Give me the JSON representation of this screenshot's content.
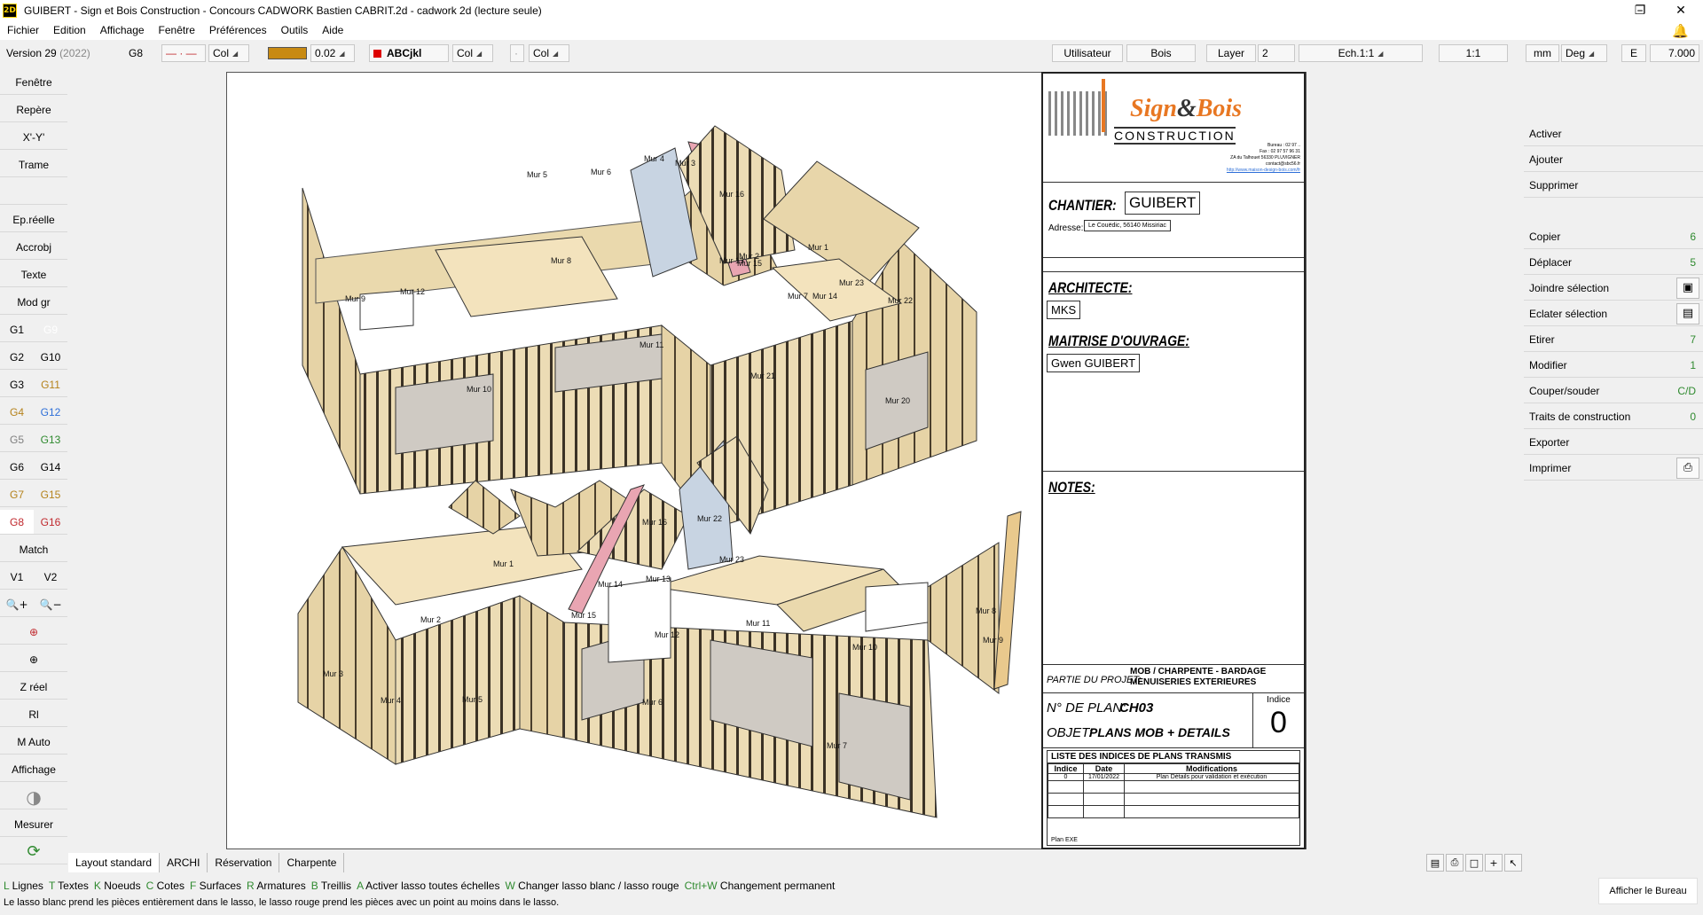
{
  "window": {
    "app_icon": "2D",
    "title": "GUIBERT - Sign et Bois Construction - Concours CADWORK Bastien CABRIT.2d - cadwork 2d (lecture seule)",
    "controls": [
      "minimize-icon",
      "restore-icon",
      "close-icon"
    ]
  },
  "menu": [
    "Fichier",
    "Edition",
    "Affichage",
    "Fenêtre",
    "Préférences",
    "Outils",
    "Aide"
  ],
  "toolbar": {
    "version": "Version 29",
    "version_year": "(2022)",
    "group": "G8",
    "line_col": "Col",
    "line_width": "0.02",
    "text_style": "ABCjkl",
    "text_col": "Col",
    "surface_col": "Col",
    "user_btn": "Utilisateur",
    "user_value": "Bois",
    "layer_btn": "Layer",
    "layer_value": "2",
    "scale": "Ech.1:1",
    "ratio": "1:1",
    "unit": "mm",
    "angle_unit": "Deg",
    "e_label": "E",
    "e_value": "7.000"
  },
  "left_panel": {
    "fenetre": "Fenêtre",
    "repere": "Repère",
    "xy": "X'-Y'",
    "trame": "Trame",
    "epreelle": "Ep.réelle",
    "accrobj": "Accrobj",
    "texte": "Texte",
    "modgr": "Mod gr",
    "groups_left": [
      "G1",
      "G2",
      "G3",
      "G4",
      "G5",
      "G6",
      "G7",
      "G8"
    ],
    "groups_right": [
      "G9",
      "G10",
      "G11",
      "G12",
      "G13",
      "G14",
      "G15",
      "G16"
    ],
    "match": "Match",
    "v1": "V1",
    "v2": "V2",
    "zreel": "Z réel",
    "rl": "Rl",
    "mauto": "M Auto",
    "affichage": "Affichage",
    "mesurer": "Mesurer"
  },
  "group_colors": {
    "G1": "#000000",
    "G2": "#000000",
    "G3": "#000000",
    "G4": "#b5821b",
    "G5": "#7f7f7f",
    "G6": "#000000",
    "G7": "#b5821b",
    "G8": "#c0282d",
    "G9": "#ffffff",
    "G10": "#000000",
    "G11": "#b5821b",
    "G12": "#2e6fd8",
    "G13": "#2f8a2f",
    "G14": "#000000",
    "G15": "#b5821b",
    "G16": "#c0282d"
  },
  "right_panel": {
    "activer": "Activer",
    "ajouter": "Ajouter",
    "supprimer": "Supprimer",
    "copier": "Copier",
    "copier_key": "6",
    "deplacer": "Déplacer",
    "deplacer_key": "5",
    "joindre": "Joindre sélection",
    "eclater": "Eclater sélection",
    "etirer": "Etirer",
    "etirer_key": "7",
    "modifier": "Modifier",
    "modifier_key": "1",
    "couper": "Couper/souder",
    "couper_key": "C/D",
    "traits": "Traits de construction",
    "traits_key": "0",
    "exporter": "Exporter",
    "imprimer": "Imprimer"
  },
  "drawing": {
    "upper_labels": [
      "Mur 5",
      "Mur 6",
      "Mur 4",
      "Mur 3",
      "Mur 16",
      "Mur 8",
      "Mur 7",
      "Mur 11",
      "Mur 2",
      "Mur 1",
      "Mur 14",
      "Mur 15",
      "Mur 23",
      "Mur 22",
      "Mur 10",
      "Mur 20",
      "Mur 21",
      "Mur 9",
      "Mur 13",
      "Mur 12"
    ],
    "lower_labels": [
      "Mur 16",
      "Mur 22",
      "Mur 23",
      "Mur 14",
      "Mur 13",
      "Mur 15",
      "Mur 1",
      "Mur 2",
      "Mur 12",
      "Mur 11",
      "Mur 3",
      "Mur 4",
      "Mur 5",
      "Mur 6",
      "Mur 7",
      "Mur 10",
      "Mur 8",
      "Mur 9"
    ]
  },
  "title_block": {
    "logo_sign": "Sign",
    "logo_and": "&",
    "logo_bois": "Bois",
    "logo_construction": "CONSTRUCTION",
    "contact": [
      "Bureau : 02 97 ..",
      "Fax : 02 97 57 96 31",
      "ZA du Talhouet 56330 PLUVIGNER",
      "contact@sbc56.fr",
      "http://www.maison-design-bois.com/fr"
    ],
    "chantier_label": "CHANTIER:",
    "chantier_value": "GUIBERT",
    "adresse_label": "Adresse:",
    "adresse_value": "Le Couëdic, 56140 Missiriac",
    "architecte_label": "ARCHITECTE:",
    "architecte_value": "MKS",
    "maitrise_label": "MAITRISE D'OUVRAGE:",
    "maitrise_value": "Gwen GUIBERT",
    "notes_label": "NOTES:",
    "partie_label": "PARTIE DU PROJET:",
    "partie_value_1": "MOB / CHARPENTE - BARDAGE",
    "partie_value_2": "MENUISERIES EXTERIEURES",
    "plan_label": "N° DE PLAN:",
    "plan_value": "CH03",
    "objet_label": "OBJET:",
    "objet_value": "PLANS MOB + DETAILS",
    "indice_label": "Indice",
    "indice_value": "0",
    "list_title": "LISTE DES INDICES DE PLANS TRANSMIS",
    "list_headers": [
      "Indice",
      "Date",
      "Modifications"
    ],
    "list_rows": [
      [
        "0",
        "17/01/2022",
        "Plan Détails pour validation et exécution"
      ]
    ],
    "plan_type": "Plan EXE"
  },
  "layout_tabs": [
    "Layout standard",
    "ARCHI",
    "Réservation",
    "Charpente"
  ],
  "status": {
    "shortcuts": [
      {
        "key": "L",
        "label": "Lignes"
      },
      {
        "key": "T",
        "label": "Textes"
      },
      {
        "key": "K",
        "label": "Noeuds"
      },
      {
        "key": "C",
        "label": "Cotes"
      },
      {
        "key": "F",
        "label": "Surfaces"
      },
      {
        "key": "R",
        "label": "Armatures"
      },
      {
        "key": "B",
        "label": "Treillis"
      },
      {
        "key": "A",
        "label": "Activer lasso toutes échelles"
      },
      {
        "key": "W",
        "label": "Changer lasso blanc / lasso rouge"
      },
      {
        "key": "Ctrl+W",
        "label": "Changement permanent"
      }
    ],
    "hint": "Le lasso blanc prend les pièces entièrement dans le lasso, le lasso rouge prend les pièces avec un point au moins dans le lasso.",
    "desktop_btn": "Afficher le Bureau"
  }
}
